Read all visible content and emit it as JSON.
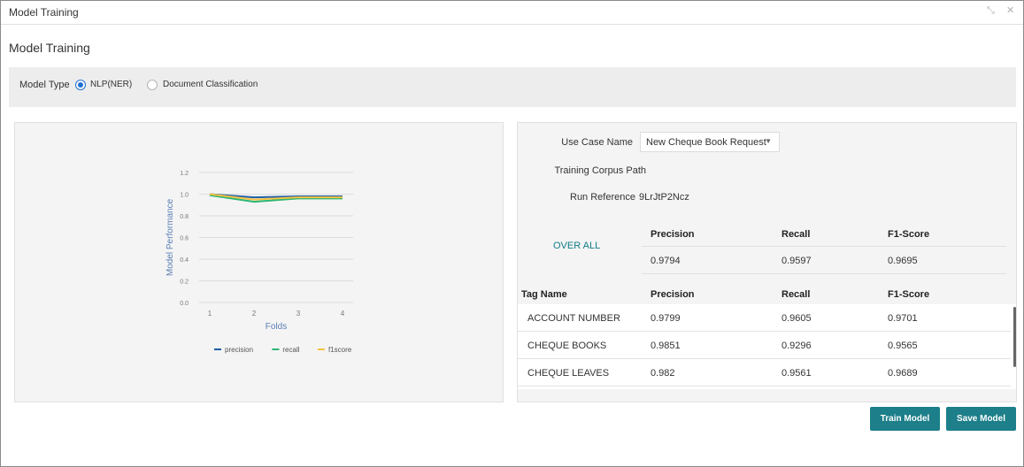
{
  "window": {
    "title": "Model Training",
    "minimize_glyph": "⤡",
    "close_glyph": "✕"
  },
  "page": {
    "heading": "Model Training"
  },
  "model_type": {
    "label": "Model Type",
    "options": [
      {
        "label": "NLP(NER)",
        "selected": true
      },
      {
        "label": "Document Classification",
        "selected": false
      }
    ]
  },
  "form": {
    "use_case_label": "Use Case Name",
    "use_case_value": "New Cheque Book Request",
    "corpus_label": "Training Corpus Path",
    "corpus_value": "",
    "run_ref_label": "Run Reference",
    "run_ref_value": "9LrJtP2Ncz"
  },
  "overall": {
    "link": "OVER ALL",
    "headers": [
      "Precision",
      "Recall",
      "F1-Score"
    ],
    "values": [
      "0.9794",
      "0.9597",
      "0.9695"
    ]
  },
  "tags": {
    "headers": [
      "Tag Name",
      "Precision",
      "Recall",
      "F1-Score"
    ],
    "rows": [
      [
        "ACCOUNT NUMBER",
        "0.9799",
        "0.9605",
        "0.9701"
      ],
      [
        "CHEQUE BOOKS",
        "0.9851",
        "0.9296",
        "0.9565"
      ],
      [
        "CHEQUE LEAVES",
        "0.982",
        "0.9561",
        "0.9689"
      ]
    ]
  },
  "buttons": {
    "train": "Train Model",
    "save": "Save Model"
  },
  "colors": {
    "accent": "#1d7f8a",
    "precision": "#1f5fa8",
    "recall": "#2bb673",
    "f1score": "#f5c242",
    "radio": "#1f6fd1"
  },
  "chart_data": {
    "type": "line",
    "title": "",
    "xlabel": "Folds",
    "ylabel": "Model Performance",
    "x": [
      1,
      2,
      3,
      4
    ],
    "ylim": [
      0,
      1.2
    ],
    "yticks": [
      "0.0",
      "0.2",
      "0.4",
      "0.6",
      "0.8",
      "1.0",
      "1.2"
    ],
    "xticks": [
      "1",
      "2",
      "3",
      "4"
    ],
    "grid": true,
    "legend_position": "bottom",
    "series": [
      {
        "name": "precision",
        "values": [
          1.0,
          0.97,
          0.98,
          0.98
        ]
      },
      {
        "name": "recall",
        "values": [
          0.99,
          0.93,
          0.96,
          0.96
        ]
      },
      {
        "name": "f1score",
        "values": [
          1.0,
          0.95,
          0.97,
          0.97
        ]
      }
    ]
  }
}
